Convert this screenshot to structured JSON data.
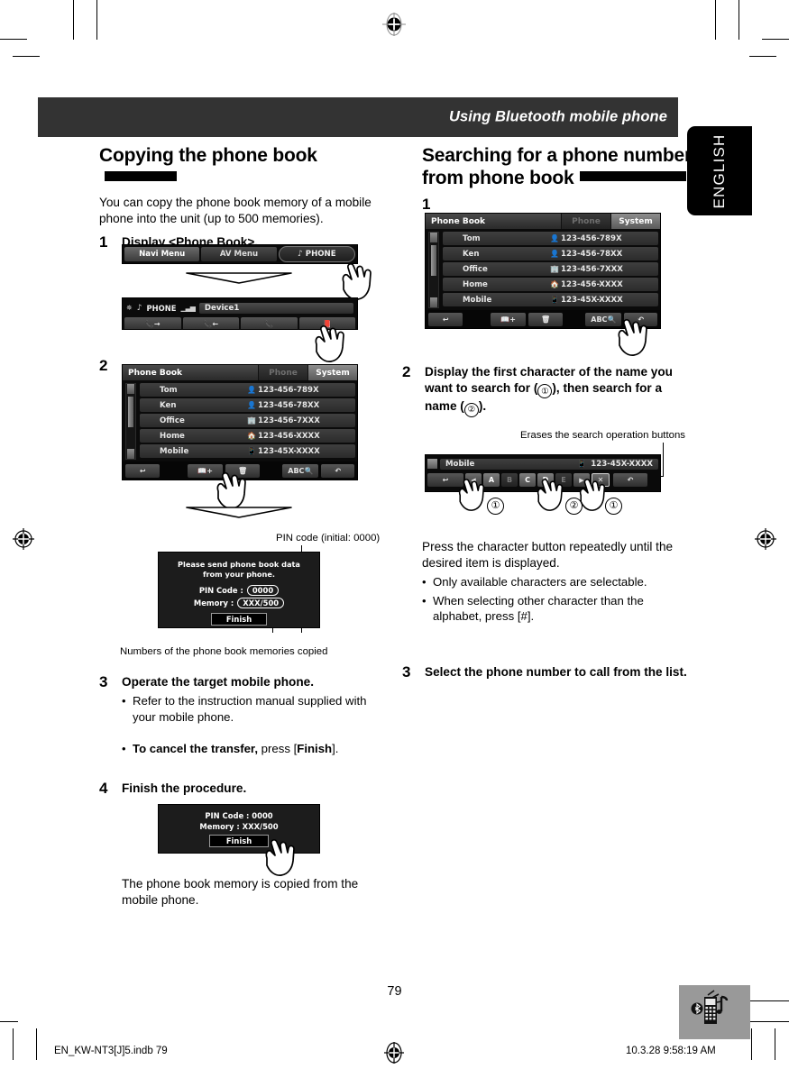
{
  "header": {
    "title": "Using Bluetooth mobile phone",
    "language_tab": "ENGLISH",
    "bar_color": "#333333"
  },
  "left_column": {
    "heading": "Copying the phone book",
    "intro": "You can copy the phone book memory of a mobile phone into the unit (up to 500 memories).",
    "steps": [
      {
        "num": "1",
        "text": "Display <Phone Book>."
      },
      {
        "num": "2",
        "text": ""
      },
      {
        "num": "3",
        "text": "Operate the target mobile phone.",
        "bullets": [
          {
            "bullet": "•",
            "text": "Refer to the instruction manual supplied with your mobile phone."
          },
          {
            "bullet": "•",
            "bold_lead": "To cancel the transfer,",
            "rest": " press [",
            "bold_tail": "Finish",
            "end": "]."
          }
        ]
      },
      {
        "num": "4",
        "text": "Finish the procedure."
      }
    ],
    "closing": "The phone book memory is copied from the mobile phone.",
    "callouts": {
      "pin_code": "PIN code (initial: 0000)",
      "memories": "Numbers of the phone book memories copied"
    },
    "screens": {
      "menu_bar": {
        "navi": "Navi Menu",
        "av": "AV Menu",
        "phone": "PHONE"
      },
      "phone_screen": {
        "label": "PHONE",
        "device": "Device1",
        "buttons": [
          "call-out-icon",
          "call-in-icon",
          "call-end-icon",
          "phonebook-icon"
        ]
      },
      "phone_book": {
        "title": "Phone Book",
        "tab_phone": "Phone",
        "tab_system": "System",
        "rows": [
          {
            "name": "Tom",
            "icon": "person-icon",
            "number": "123-456-789X"
          },
          {
            "name": "Ken",
            "icon": "person-icon",
            "number": "123-456-78XX"
          },
          {
            "name": "Office",
            "icon": "building-icon",
            "number": "123-456-7XXX"
          },
          {
            "name": "Home",
            "icon": "home-icon",
            "number": "123-456-XXXX"
          },
          {
            "name": "Mobile",
            "icon": "mobile-icon",
            "number": "123-45X-XXXX"
          }
        ],
        "buttons": [
          "back-icon",
          "add-contact-icon",
          "delete-icon",
          "ABC",
          "transfer-icon"
        ]
      },
      "pin_dialog": {
        "message": "Please send phone book data from your phone.",
        "pin_label": "PIN Code :",
        "pin_value": "0000",
        "memory_label": "Memory :",
        "memory_value": "XXX/500",
        "finish": "Finish"
      },
      "finish_dialog": {
        "pin_line": "PIN Code : 0000",
        "memory_line": "Memory : XXX/500",
        "finish": "Finish"
      }
    }
  },
  "right_column": {
    "heading_line1": "Searching for a phone number",
    "heading_line2": "from phone book",
    "steps": [
      {
        "num": "1",
        "text": ""
      },
      {
        "num": "2",
        "text_part1": "Display the first character of the name you want to search for (",
        "c1": "①",
        "text_part2": "), then search for a name (",
        "c2": "②",
        "text_part3": ")."
      },
      {
        "num": "3",
        "text": "Select the phone number to call from the list."
      }
    ],
    "note": "Press the character button repeatedly until the desired item is displayed.",
    "bullets": [
      {
        "bullet": "•",
        "text": "Only available characters are selectable."
      },
      {
        "bullet": "•",
        "text": "When selecting other character than the alphabet, press [#]."
      }
    ],
    "callouts": {
      "erase": "Erases the search operation buttons"
    },
    "screens": {
      "phone_book": {
        "title": "Phone Book",
        "tab_phone": "Phone",
        "tab_system": "System",
        "rows": [
          {
            "name": "Tom",
            "icon": "person-icon",
            "number": "123-456-789X"
          },
          {
            "name": "Ken",
            "icon": "person-icon",
            "number": "123-456-78XX"
          },
          {
            "name": "Office",
            "icon": "building-icon",
            "number": "123-456-7XXX"
          },
          {
            "name": "Home",
            "icon": "home-icon",
            "number": "123-456-XXXX"
          },
          {
            "name": "Mobile",
            "icon": "mobile-icon",
            "number": "123-45X-XXXX"
          }
        ],
        "buttons": [
          "back-icon",
          "add-contact-icon",
          "delete-icon",
          "ABC",
          "transfer-icon"
        ]
      },
      "search_bar": {
        "row_name": "Mobile",
        "row_number": "123-45X-XXXX",
        "prev": "◀",
        "letters": [
          "A",
          "B",
          "C",
          "D",
          "E"
        ],
        "next": "▶",
        "close": "✕",
        "marks": {
          "left": "①",
          "mid": "②",
          "right": "①"
        }
      }
    }
  },
  "footer": {
    "page_number": "79",
    "file": "EN_KW-NT3[J]5.indb   79",
    "timestamp": "10.3.28   9:58:19 AM",
    "icon": "bluetooth-phone-music-icon"
  }
}
